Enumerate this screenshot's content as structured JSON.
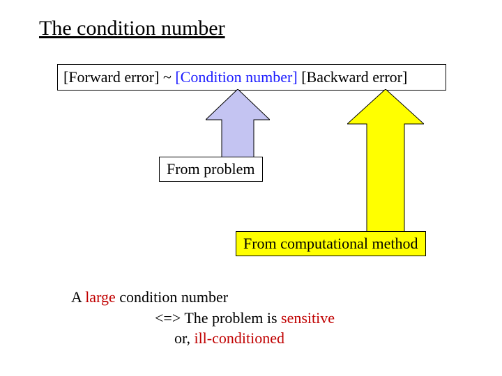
{
  "title": "The condition number",
  "equation": {
    "forward": "[Forward error]",
    "tilde": " ~ ",
    "condition": "[Condition number]",
    "space": " ",
    "backward": "[Backward error]"
  },
  "boxes": {
    "from_problem": "From problem",
    "from_method": "From computational method"
  },
  "arrows": {
    "purple_fill": "#c4c4f2",
    "yellow_fill": "#ffff00",
    "stroke": "#000000"
  },
  "conclusion": {
    "line1_prefix": "A ",
    "line1_large": "large",
    "line1_suffix": " condition number",
    "line2_prefix": "<=> The problem is ",
    "line2_sensitive": "sensitive",
    "line3_prefix": "or, ",
    "line3_ill": "ill-conditioned"
  }
}
